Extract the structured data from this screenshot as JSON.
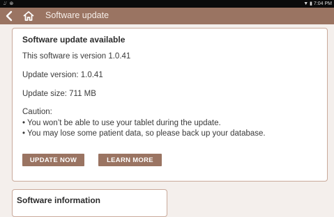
{
  "status_bar": {
    "left_icons": "⌰ ⊛",
    "right": "▼ ▮ 7:04 PM"
  },
  "app_bar": {
    "title": "Software update"
  },
  "update_card": {
    "heading": "Software update available",
    "current_version": "This software is version 1.0.41",
    "update_version_label": "Update version:",
    "update_version_value": " 1.0.41",
    "update_size_label": "Update size:",
    "update_size_value": " 711 MB",
    "caution_title": "Caution:",
    "caution_items": [
      "• You won’t be able to use your tablet during the update.",
      "• You may lose some patient data, so please back up your database."
    ],
    "buttons": {
      "update_now": "UPDATE NOW",
      "learn_more": "LEARN MORE"
    }
  },
  "info_card": {
    "heading": "Software information"
  },
  "colors": {
    "app_bar": "#9a7462",
    "background": "#f4efec",
    "card_border": "#c9a99a"
  }
}
